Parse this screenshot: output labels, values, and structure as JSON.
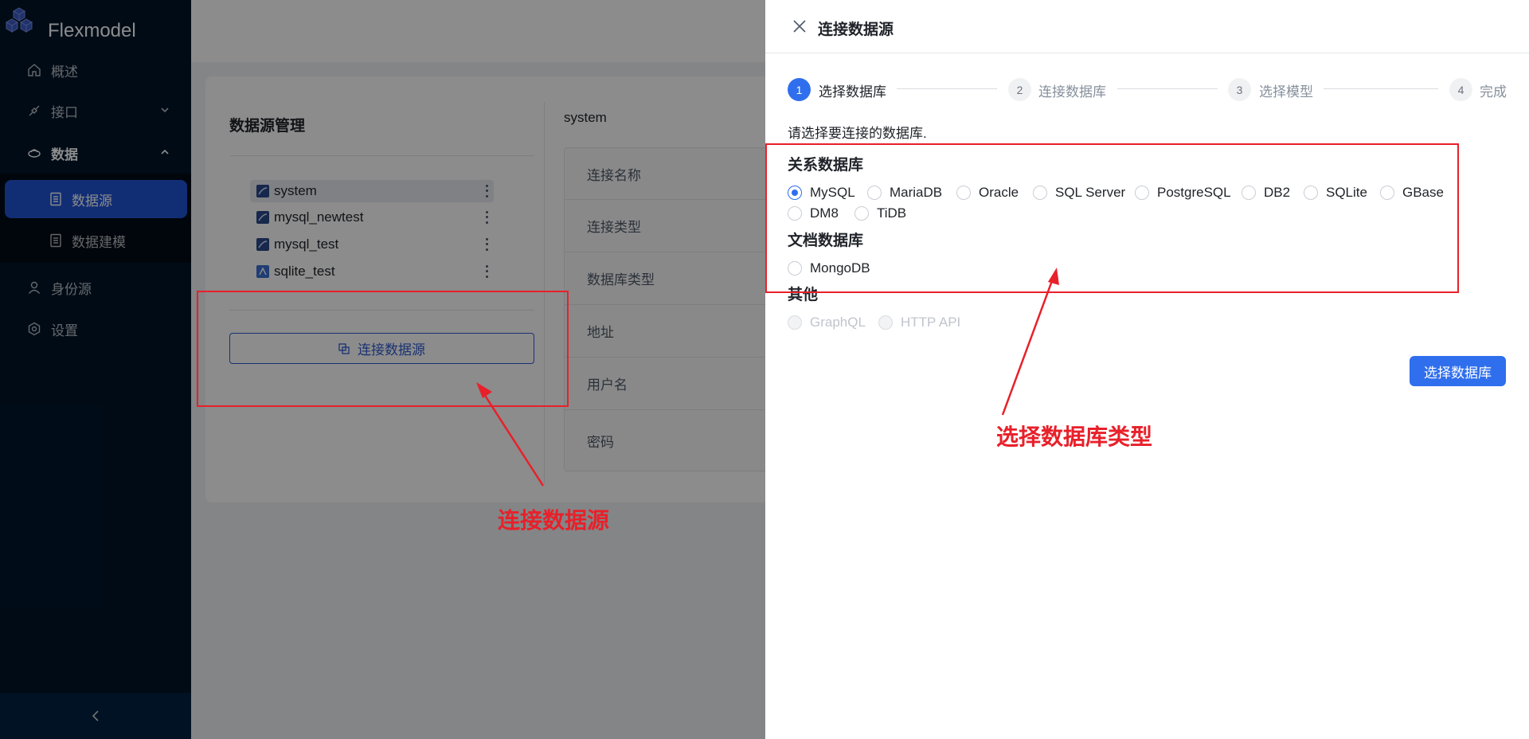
{
  "app": {
    "brand": "Flexmodel"
  },
  "sidebar": {
    "items": [
      {
        "label": "概述",
        "icon": "home-icon"
      },
      {
        "label": "接口",
        "icon": "api-icon"
      },
      {
        "label": "数据",
        "icon": "cloud-icon"
      },
      {
        "label": "身份源",
        "icon": "user-icon"
      },
      {
        "label": "设置",
        "icon": "gear-icon"
      }
    ],
    "data_sub": [
      {
        "label": "数据源",
        "icon": "file-icon"
      },
      {
        "label": "数据建模",
        "icon": "file-icon"
      }
    ],
    "collapse": "<"
  },
  "datasource_panel": {
    "title": "数据源管理",
    "items": [
      {
        "name": "system",
        "icon": "mysql-icon"
      },
      {
        "name": "mysql_newtest",
        "icon": "mysql-icon"
      },
      {
        "name": "mysql_test",
        "icon": "mysql-icon"
      },
      {
        "name": "sqlite_test",
        "icon": "sqlite-icon"
      }
    ],
    "connect_button": "连接数据源"
  },
  "detail": {
    "name": "system",
    "rows": [
      "连接名称",
      "连接类型",
      "数据库类型",
      "地址",
      "用户名",
      "密码"
    ]
  },
  "drawer": {
    "title": "连接数据源",
    "steps": [
      {
        "num": "1",
        "label": "选择数据库"
      },
      {
        "num": "2",
        "label": "连接数据库"
      },
      {
        "num": "3",
        "label": "选择模型"
      },
      {
        "num": "4",
        "label": "完成"
      }
    ],
    "prompt": "请选择要连接的数据库.",
    "groups": {
      "relational": {
        "title": "关系数据库",
        "options": [
          "MySQL",
          "MariaDB",
          "Oracle",
          "SQL Server",
          "PostgreSQL",
          "DB2",
          "SQLite",
          "GBase",
          "DM8",
          "TiDB"
        ],
        "selected": "MySQL"
      },
      "document": {
        "title": "文档数据库",
        "options": [
          "MongoDB"
        ]
      },
      "other": {
        "title": "其他",
        "options": [
          "GraphQL",
          "HTTP API"
        ]
      }
    },
    "next_button": "选择数据库"
  },
  "annotations": {
    "left_label": "连接数据源",
    "right_label": "选择数据库类型",
    "color": "#e8202a"
  },
  "colors": {
    "sidebar_bg": "#001529",
    "primary": "#2f6fed",
    "active_menu": "#1f54d6"
  }
}
